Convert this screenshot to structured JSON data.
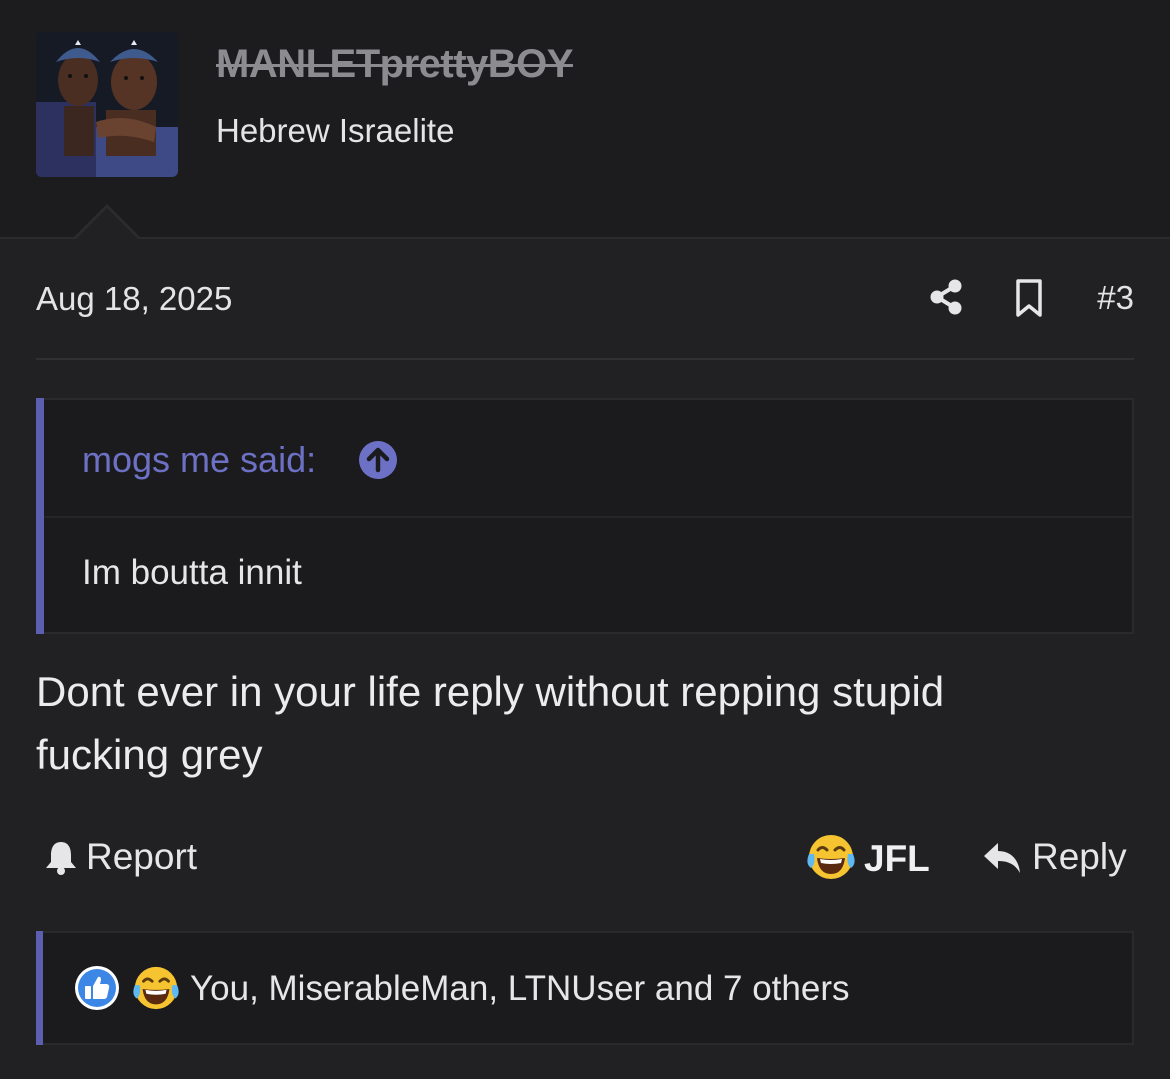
{
  "user": {
    "username": "MANLETprettyBOY",
    "title": "Hebrew Israelite",
    "avatar": "avatar-photo-icon"
  },
  "post": {
    "date": "Aug 18, 2025",
    "number": "#3",
    "share_icon": "share-icon",
    "bookmark_icon": "bookmark-icon"
  },
  "quote": {
    "author_label": "mogs me said:",
    "arrow_icon": "arrow-up-circle-icon",
    "text": "Im boutta innit"
  },
  "body": {
    "line1": "Dont ever in your life reply without repping stupid",
    "line2": "fucking grey"
  },
  "actions": {
    "report_label": "Report",
    "react_label": "JFL",
    "reply_label": "Reply"
  },
  "reactions": {
    "summary": "You, MiserableMan, LTNUser and 7 others",
    "icons": [
      "like-icon",
      "laugh-cry-icon"
    ]
  },
  "colors": {
    "background": "#212123",
    "header_bg": "#1c1c1e",
    "accent": "#5c5fb0",
    "quote_author": "#6d71c6"
  }
}
